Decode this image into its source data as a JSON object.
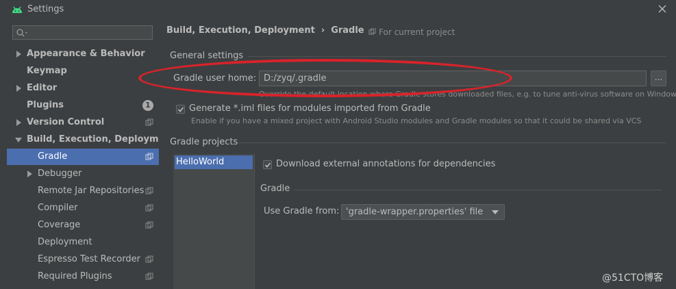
{
  "window": {
    "title": "Settings"
  },
  "sidebar": {
    "search_placeholder": "",
    "items": [
      {
        "label": "Appearance & Behavior"
      },
      {
        "label": "Keymap"
      },
      {
        "label": "Editor"
      },
      {
        "label": "Plugins",
        "badge": "1"
      },
      {
        "label": "Version Control"
      },
      {
        "label": "Build, Execution, Deployment"
      },
      {
        "label": "Gradle"
      },
      {
        "label": "Debugger"
      },
      {
        "label": "Remote Jar Repositories"
      },
      {
        "label": "Compiler"
      },
      {
        "label": "Coverage"
      },
      {
        "label": "Deployment"
      },
      {
        "label": "Espresso Test Recorder"
      },
      {
        "label": "Required Plugins"
      }
    ]
  },
  "breadcrumb": {
    "parent": "Build, Execution, Deployment",
    "separator": "›",
    "current": "Gradle"
  },
  "scope": {
    "label": "For current project"
  },
  "general": {
    "title": "General settings",
    "user_home_label": "Gradle user home:",
    "user_home_value": "D:/zyq/.gradle",
    "browse_label": "...",
    "user_home_hint": "Override the default location where Gradle stores downloaded files, e.g. to tune anti-virus software on Windows",
    "iml_label": "Generate *.iml files for modules imported from Gradle",
    "iml_checked": true,
    "iml_hint": "Enable if you have a mixed project with Android Studio modules and Gradle modules so that it could be shared via VCS"
  },
  "projects": {
    "title": "Gradle projects",
    "list": [
      "HelloWorld"
    ],
    "download_annotations_label": "Download external annotations for dependencies",
    "download_annotations_checked": true,
    "gradle_group_title": "Gradle",
    "use_gradle_from_label": "Use Gradle from:",
    "use_gradle_from_value": "'gradle-wrapper.properties' file"
  },
  "watermark": "@51CTO博客",
  "colors": {
    "accent": "#4b6eaf",
    "annotation": "#d8232a",
    "background": "#3c3f41"
  }
}
